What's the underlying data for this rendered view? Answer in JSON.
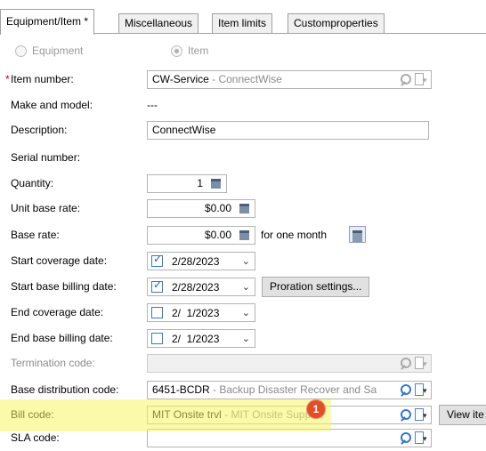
{
  "tabs": [
    {
      "label": "Equipment/Item *",
      "active": true
    },
    {
      "label": "Miscellaneous",
      "active": false
    },
    {
      "label": "Item limits",
      "active": false
    },
    {
      "label": "Customproperties",
      "active": false
    }
  ],
  "type_radio": {
    "equipment_label": "Equipment",
    "item_label": "Item",
    "selected": "Item"
  },
  "item_number": {
    "required_mark": "*",
    "label": "Item number:",
    "code": "CW-Service",
    "desc": " - ConnectWise"
  },
  "make_model": {
    "label": "Make and model:",
    "value": "---"
  },
  "description": {
    "label": "Description:",
    "value": "ConnectWise"
  },
  "serial_number": {
    "label": "Serial number:"
  },
  "quantity": {
    "label": "Quantity:",
    "value": "1"
  },
  "unit_base_rate": {
    "label": "Unit base rate:",
    "value": "$0.00"
  },
  "base_rate": {
    "label": "Base rate:",
    "value": "$0.00",
    "suffix": "for one month"
  },
  "start_coverage": {
    "label": "Start coverage date:",
    "checked": true,
    "value": "2/28/2023"
  },
  "start_billing": {
    "label": "Start base billing date:",
    "checked": true,
    "value": "2/28/2023",
    "button": "Proration settings..."
  },
  "end_coverage": {
    "label": "End coverage date:",
    "checked": false,
    "value": "2/  1/2023"
  },
  "end_billing": {
    "label": "End base billing date:",
    "checked": false,
    "value": "2/  1/2023"
  },
  "termination_code": {
    "label": "Termination code:",
    "value": ""
  },
  "base_distribution": {
    "label": "Base distribution code:",
    "code": "6451-BCDR",
    "desc": " - Backup Disaster Recover and Sa"
  },
  "bill_code": {
    "label": "Bill code:",
    "code": "MIT Onsite trvl",
    "desc": " - MIT Onsite Support",
    "side_button": "View ite"
  },
  "sla_code": {
    "label": "SLA code:",
    "value": ""
  },
  "annotation": {
    "badge": "1",
    "highlight_color": "#f5f564",
    "badge_color": "#e04e2a"
  }
}
